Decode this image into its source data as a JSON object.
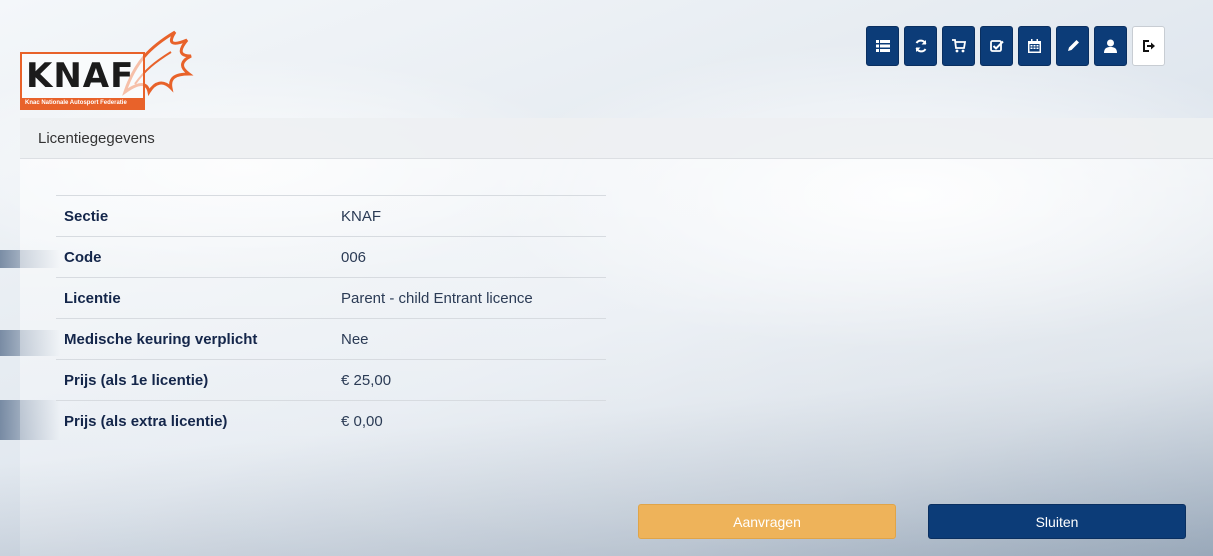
{
  "logo": {
    "name": "KNAF",
    "subtitle": "Knac Nationale Autosport Federatie",
    "accent_color": "#e8622a"
  },
  "toolbar": {
    "icons": [
      "list-icon",
      "refresh-icon",
      "cart-icon",
      "checkbox-icon",
      "calendar-icon",
      "pencil-icon",
      "user-icon",
      "logout-icon"
    ],
    "color": "#0c3c78"
  },
  "panel": {
    "title": "Licentiegegevens"
  },
  "details": [
    {
      "label": "Sectie",
      "value": "KNAF"
    },
    {
      "label": "Code",
      "value": "006"
    },
    {
      "label": "Licentie",
      "value": "Parent - child Entrant licence"
    },
    {
      "label": "Medische keuring verplicht",
      "value": "Nee"
    },
    {
      "label": "Prijs (als 1e licentie)",
      "value": "€ 25,00"
    },
    {
      "label": "Prijs (als extra licentie)",
      "value": "€ 0,00"
    }
  ],
  "actions": {
    "apply_label": "Aanvragen",
    "apply_color": "#eeb35a",
    "close_label": "Sluiten",
    "close_color": "#0c3c78"
  }
}
